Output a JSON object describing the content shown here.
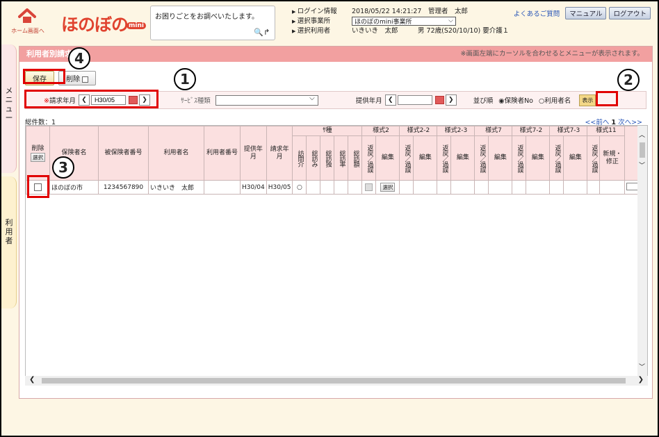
{
  "header": {
    "home_label": "ホーム画面へ",
    "logo_text": "ほのぼの",
    "logo_mini": "mini",
    "question_text": "お困りごとをお調べいたします。",
    "login_label": "ログイン情報",
    "login_value": "2018/05/22 14:21:27　管理者　太郎",
    "office_label": "選択事業所",
    "office_value": "ほのぼのmini事業所",
    "user_label": "選択利用者",
    "user_value": "いきいき　太郎　　　男 72歳(S20/10/10) 要介護１",
    "faq": "よくあるご質問",
    "manual": "マニュアル",
    "logout": "ログアウト"
  },
  "side": {
    "menu": "メニュー",
    "user": "利用者"
  },
  "panel": {
    "title": "利用者別請求一覧",
    "note": "※画面左端にカーソルを合わせるとメニューが表示されます。",
    "save": "保存",
    "delete": "削除"
  },
  "filter": {
    "billing_label": "請求年月",
    "billing_req": "※",
    "billing_value": "H30/05",
    "service_label": "ｻｰﾋﾞｽ種類",
    "service_value": "",
    "provide_label": "提供年月",
    "provide_value": "",
    "sort_label": "並び順",
    "sort_opt1": "保険者No",
    "sort_opt2": "利用者名",
    "show": "表示"
  },
  "list": {
    "count": "総件数：1",
    "prev": "<<前へ",
    "page": "1",
    "next": "次へ>>"
  },
  "table": {
    "delete_col": "削除",
    "select_btn": "選択",
    "insurer_name": "保険者名",
    "insured_no": "被保険者番号",
    "user_name": "利用者名",
    "user_no": "利用者番号",
    "provide_ym": "提供年月",
    "billing_ym": "請求年月",
    "kind": "ｻ種",
    "kinds": [
      "訪問介",
      "総訪み",
      "総訪独",
      "総訪率",
      "総訪額"
    ],
    "forms": [
      "様式2",
      "様式2-2",
      "様式2-3",
      "様式7",
      "様式7-2",
      "様式7-3",
      "様式11"
    ],
    "back": "返戻／過誤",
    "edit": "編集",
    "new_fix": "新規・修正",
    "row": {
      "insurer": "ほのぼの市",
      "insured": "1234567890",
      "name": "いきいき　太郎",
      "user_no": "",
      "provide": "H30/04",
      "billing": "H30/05",
      "visit": "○",
      "sel": "選択"
    }
  },
  "annotations": [
    "1",
    "2",
    "3",
    "4"
  ]
}
